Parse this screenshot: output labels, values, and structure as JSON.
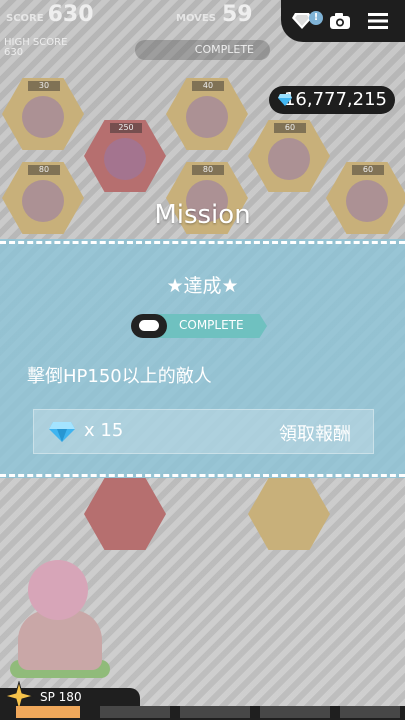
{
  "hud": {
    "score_label": "SCORE",
    "score_value": "630",
    "moves_label": "MOVES",
    "moves_value": "59",
    "best_label": "HIGH SCORE",
    "best_value": "630",
    "status_label": "COMPLETE",
    "notification_badge": "!"
  },
  "currency": {
    "gems_value": "16,777,215"
  },
  "board": {
    "tile_levels": [
      "30",
      "40",
      "250",
      "60",
      "80",
      "80",
      "60"
    ]
  },
  "mission": {
    "title": "Mission",
    "achieved_text": "★達成★",
    "status_text": "COMPLETE",
    "description": "擊倒HP150以上的敵人",
    "reward_count": "x 15",
    "claim_label": "領取報酬"
  },
  "player": {
    "sp_text": "SP 180",
    "sp_fill_fraction": 0.2
  }
}
